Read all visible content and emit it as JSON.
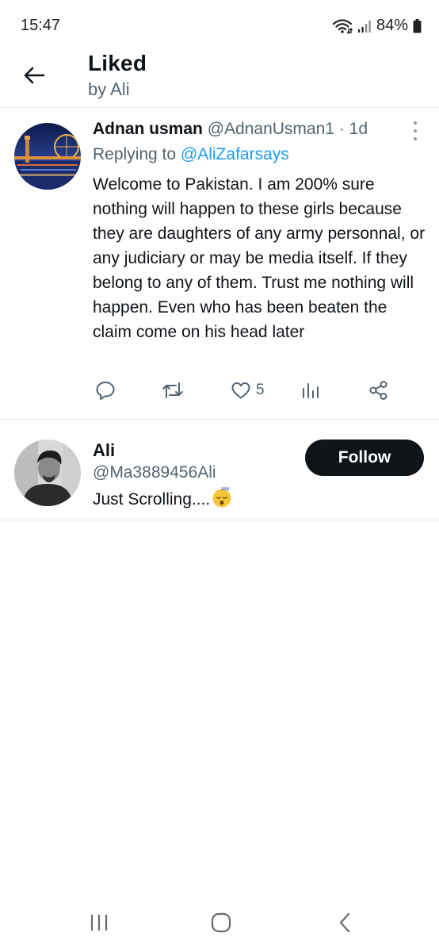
{
  "status_bar": {
    "time": "15:47",
    "battery": "84%",
    "icons": [
      "wifi-icon",
      "signal-icon",
      "battery-icon"
    ]
  },
  "header": {
    "title": "Liked",
    "subtitle": "by Ali",
    "back_icon": "arrow-left-icon"
  },
  "tweet": {
    "author_name": "Adnan usman",
    "author_handle": "@AdnanUsman1",
    "separator": "·",
    "time": "1d",
    "replying_prefix": "Replying to",
    "replying_to": "@AliZafarsays",
    "text": "Welcome to Pakistan. I am 200% sure nothing will happen to these girls because they are daughters of any army personnal, or any judiciary or may be media itself. If they belong to any of them. Trust me nothing will happen. Even who has been beaten the claim come on his head later",
    "like_count": "5",
    "action_icons": [
      "reply-icon",
      "retweet-icon",
      "like-icon",
      "views-icon",
      "share-icon"
    ]
  },
  "user_card": {
    "name": "Ali",
    "handle": "@Ma3889456Ali",
    "bio": "Just Scrolling....",
    "bio_emoji": "sleeping-face-emoji",
    "follow_label": "Follow"
  },
  "nav_bar": {
    "icons": [
      "recent-apps-icon",
      "home-icon",
      "back-icon"
    ]
  },
  "colors": {
    "text_primary": "#0f1419",
    "text_secondary": "#536471",
    "link": "#1d9bf0",
    "follow_bg": "#0f1419",
    "divider": "#e6e9eb"
  }
}
